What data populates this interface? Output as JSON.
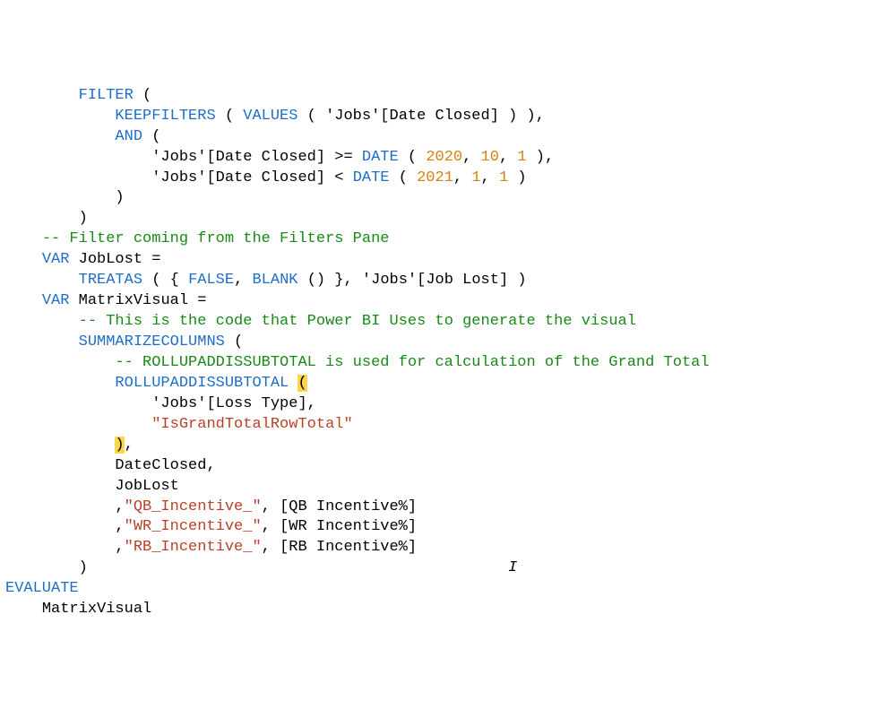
{
  "sp": " ",
  "indent": {
    "i2": "        ",
    "i3": "            ",
    "i4": "                ",
    "i5": "                    ",
    "i35": "             ",
    "i1": "    ",
    "i0": ""
  },
  "code": {
    "l1": {
      "kw": "FILTER",
      "open": " ("
    },
    "l2": {
      "fn": "KEEPFILTERS",
      "open": " ( ",
      "fn2": "VALUES",
      "open2": " ( ",
      "col": "'Jobs'[Date Closed]",
      "close": " ) ),"
    },
    "l3": {
      "fn": "AND",
      "open": " ("
    },
    "l4": {
      "col": "'Jobs'[Date Closed]",
      "op": " >= ",
      "fn": "DATE",
      "open": " ( ",
      "n1": "2020",
      "c": ", ",
      "n2": "10",
      "n3": "1",
      "close": " ),"
    },
    "l5": {
      "col": "'Jobs'[Date Closed]",
      "op": " < ",
      "fn": "DATE",
      "open": " ( ",
      "n1": "2021",
      "c": ", ",
      "n2": "1",
      "n3": "1",
      "close": " )"
    },
    "l6": {
      "close": ")"
    },
    "l7": {
      "close": ")"
    },
    "l8": {
      "cmt": "-- Filter coming from the Filters Pane"
    },
    "l9": {
      "kw": "VAR",
      "id": "JobLost",
      "eq": " ="
    },
    "l10": {
      "fn": "TREATAS",
      "open": " ( { ",
      "fn2": "FALSE",
      "c": ", ",
      "fn3": "BLANK",
      "open2": " ()",
      "close1": " }, ",
      "col": "'Jobs'[Job Lost]",
      "close2": " )"
    },
    "l11": {
      "kw": "VAR",
      "id": "MatrixVisual",
      "eq": " ="
    },
    "l12": {
      "cmt": "-- This is the code that Power BI Uses to generate the visual"
    },
    "l13": {
      "fn": "SUMMARIZECOLUMNS",
      "open": " ("
    },
    "l14": {
      "cmt": "-- ROLLUPADDISSUBTOTAL is used for calculation of the Grand Total"
    },
    "l15": {
      "fn": "ROLLUPADDISSUBTOTAL",
      "open": "("
    },
    "l16": {
      "col": "'Jobs'[Loss Type]",
      "c": ","
    },
    "l17": {
      "str": "\"IsGrandTotalRowTotal\""
    },
    "l18": {
      "close": ")",
      "c": ","
    },
    "l19": {
      "id": "DateClosed",
      "c": ","
    },
    "l20": {
      "id": "JobLost"
    },
    "l21": {
      "c": ",",
      "str": "\"QB_Incentive_\"",
      "c2": ", ",
      "col": "[QB Incentive%]"
    },
    "l22": {
      "c": ",",
      "str": "\"WR_Incentive_\"",
      "c2": ", ",
      "col": "[WR Incentive%]"
    },
    "l23": {
      "c": ",",
      "str": "\"RB_Incentive_\"",
      "c2": ", ",
      "col": "[RB Incentive%]"
    },
    "l24": {
      "close": ")"
    },
    "l25": {
      "kw": "EVALUATE"
    },
    "l26": {
      "id": "MatrixVisual"
    }
  }
}
